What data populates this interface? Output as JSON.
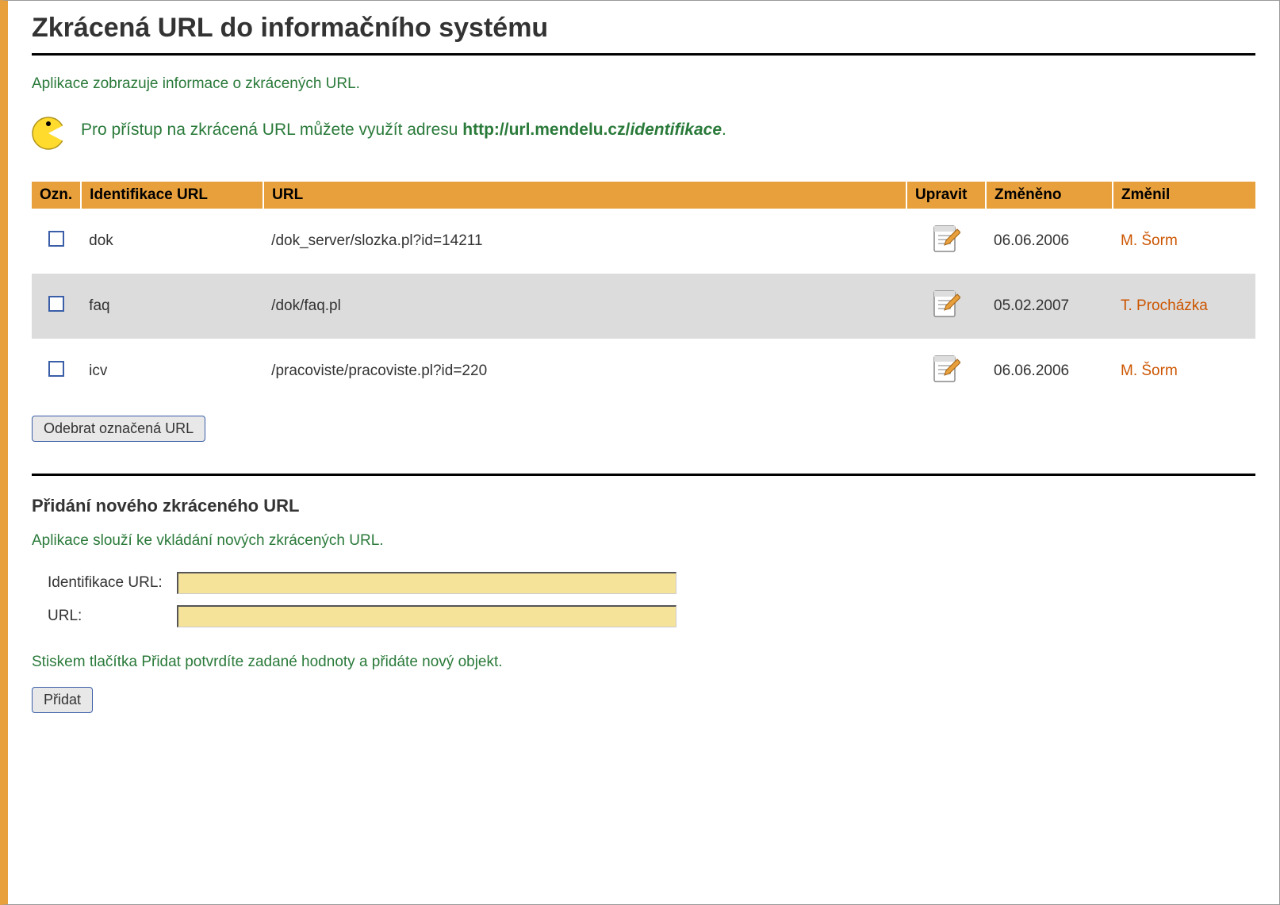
{
  "page_title": "Zkrácená URL do informačního systému",
  "intro_text": "Aplikace zobrazuje informace o zkrácených URL.",
  "tip": {
    "prefix": "Pro přístup na zkrácená URL můžete využít adresu ",
    "url_bold": "http://url.mendelu.cz/",
    "url_italic": "identifikace",
    "suffix": "."
  },
  "table": {
    "headers": {
      "ozn": "Ozn.",
      "ident": "Identifikace URL",
      "url": "URL",
      "edit": "Upravit",
      "date": "Změněno",
      "user": "Změnil"
    },
    "rows": [
      {
        "ident": "dok",
        "url": "/dok_server/slozka.pl?id=14211",
        "date": "06.06.2006",
        "user": "M. Šorm"
      },
      {
        "ident": "faq",
        "url": "/dok/faq.pl",
        "date": "05.02.2007",
        "user": "T. Procházka"
      },
      {
        "ident": "icv",
        "url": "/pracoviste/pracoviste.pl?id=220",
        "date": "06.06.2006",
        "user": "M. Šorm"
      }
    ]
  },
  "remove_button": "Odebrat označená URL",
  "add_section": {
    "heading": "Přidání nového zkráceného URL",
    "intro": "Aplikace slouží ke vkládání nových zkrácených URL.",
    "label_ident": "Identifikace URL:",
    "label_url": "URL:",
    "value_ident": "",
    "value_url": "",
    "instruction": "Stiskem tlačítka Přidat potvrdíte zadané hodnoty a přidáte nový objekt.",
    "button": "Přidat"
  }
}
